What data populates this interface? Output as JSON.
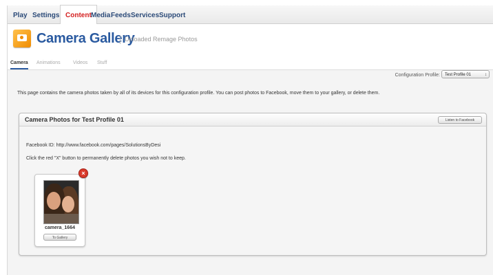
{
  "top_nav": {
    "tabs": [
      {
        "label": "Play",
        "active": false
      },
      {
        "label": "Settings",
        "active": false
      },
      {
        "label": "Content",
        "active": true
      },
      {
        "label": "Media",
        "active": false
      },
      {
        "label": "Feeds",
        "active": false
      },
      {
        "label": "Services",
        "active": false
      },
      {
        "label": "Support",
        "active": false
      }
    ]
  },
  "header": {
    "title": "Camera Gallery",
    "subtitle": "Uploaded Remage Photos",
    "icon": "camera-gallery-icon",
    "accent_color": "#2a5aa0"
  },
  "sub_tabs": [
    {
      "label": "Camera",
      "active": true
    },
    {
      "label": "Animations",
      "active": false
    },
    {
      "label": "Videos",
      "active": false
    },
    {
      "label": "Stuff",
      "active": false
    }
  ],
  "config": {
    "label": "Configuration Profile:",
    "selected": "Test Profile 01"
  },
  "description": "This page contains the camera photos taken by all of its devices for this configuration profile. You can post photos to Facebook, move them to your gallery, or delete them.",
  "panel": {
    "title": "Camera Photos for Test Profile 01",
    "facebook_button": "Listen to Facebook",
    "facebook_id": "Facebook ID: http://www.facebook.com/pages/SolutionsByDesi",
    "instructions": "Click the red \"X\" button to permanently delete photos you wish not to keep.",
    "photos": [
      {
        "name": "camera_1664",
        "button": "To Gallery"
      }
    ]
  }
}
